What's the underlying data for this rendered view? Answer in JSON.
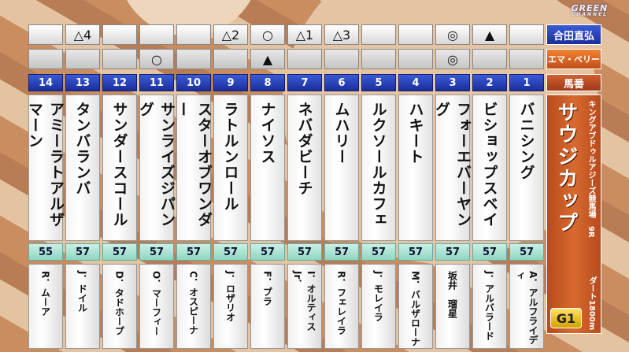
{
  "channel_logo": {
    "main": "GREEN",
    "sub": "CHANNEL"
  },
  "predictors": [
    {
      "name": "合田直弘",
      "marks": [
        "",
        "△4",
        "",
        "",
        "",
        "△2",
        "○",
        "△1",
        "△3",
        "",
        "",
        "◎",
        "▲",
        ""
      ]
    },
    {
      "name": "エマ・ベリー",
      "marks": [
        "",
        "",
        "",
        "○",
        "",
        "",
        "▲",
        "",
        "",
        "",
        "",
        "◎",
        "",
        ""
      ]
    }
  ],
  "post_label": "馬番",
  "horses": [
    {
      "num": "14",
      "name": "アミーラトアルザマーン",
      "weight": "55",
      "jockey": "R．ムーア"
    },
    {
      "num": "13",
      "name": "タンバランバ",
      "weight": "57",
      "jockey": "J．ドイル"
    },
    {
      "num": "12",
      "name": "サンダースコール",
      "weight": "57",
      "jockey": "D．タドホープ"
    },
    {
      "num": "11",
      "name": "サンライズジパング",
      "weight": "57",
      "jockey": "O．マーフィー"
    },
    {
      "num": "10",
      "name": "スターオブワンダー",
      "weight": "57",
      "jockey": "C．オスピーナ"
    },
    {
      "num": "9",
      "name": "ラトルンロール",
      "weight": "57",
      "jockey": "J．ロザリオ"
    },
    {
      "num": "8",
      "name": "ナイソス",
      "weight": "57",
      "jockey": "F．プラ"
    },
    {
      "num": "7",
      "name": "ネバダビーチ",
      "weight": "57",
      "jockey": "I．オルティスJr．"
    },
    {
      "num": "6",
      "name": "ムハリー",
      "weight": "57",
      "jockey": "R．フェレイラ"
    },
    {
      "num": "5",
      "name": "ルクソールカフェ",
      "weight": "57",
      "jockey": "J．モレイラ"
    },
    {
      "num": "4",
      "name": "ハキート",
      "weight": "57",
      "jockey": "M．バルザローナ"
    },
    {
      "num": "3",
      "name": "フォーエバーヤング",
      "weight": "57",
      "jockey": "坂井　瑠星"
    },
    {
      "num": "2",
      "name": "ビショップスベイ",
      "weight": "57",
      "jockey": "J．アルバラード"
    },
    {
      "num": "1",
      "name": "バニシング",
      "weight": "57",
      "jockey": "A．アルフライディ"
    }
  ],
  "race": {
    "title": "サウジカップ",
    "track": "キングアブドゥルアジーズ競馬場",
    "race_no": "9R",
    "surface_distance": "ダート1800m",
    "grade": "G1"
  }
}
